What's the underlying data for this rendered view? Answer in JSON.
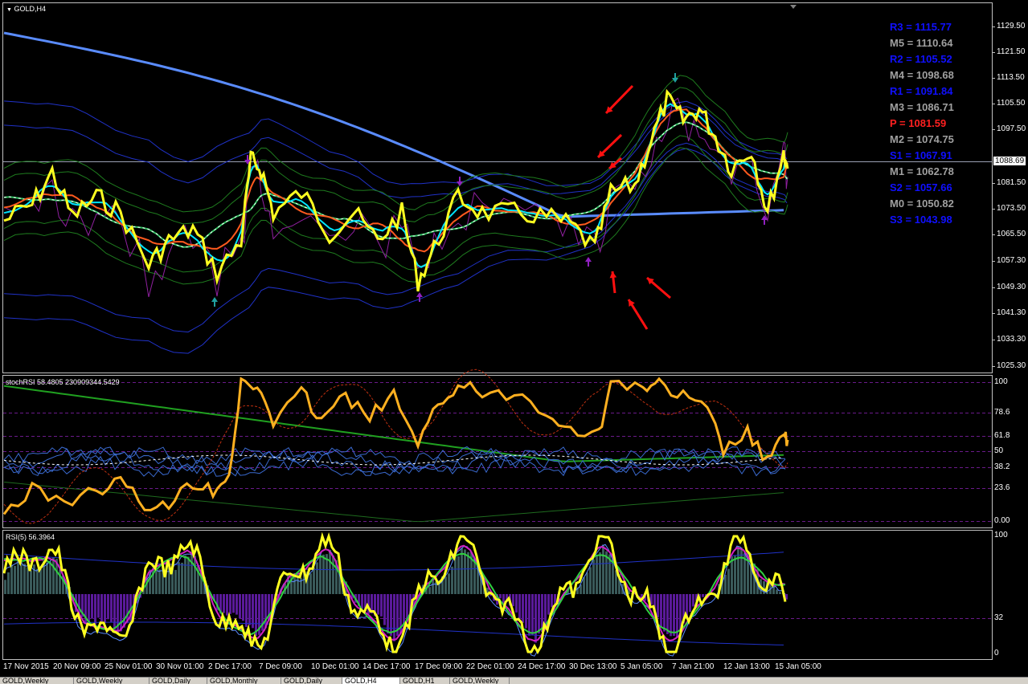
{
  "window": {
    "symbol_label": "GOLD,H4"
  },
  "pivots": [
    {
      "text": "R3 = 1115.77",
      "color": "#1010ff"
    },
    {
      "text": "M5 = 1110.64",
      "color": "#a0a0a0"
    },
    {
      "text": "R2 = 1105.52",
      "color": "#1010ff"
    },
    {
      "text": "M4 = 1098.68",
      "color": "#a0a0a0"
    },
    {
      "text": "R1 = 1091.84",
      "color": "#1010ff"
    },
    {
      "text": "M3 = 1086.71",
      "color": "#a0a0a0"
    },
    {
      "text": "P  = 1081.59",
      "color": "#ff2020"
    },
    {
      "text": "M2 = 1074.75",
      "color": "#a0a0a0"
    },
    {
      "text": "S1 = 1067.91",
      "color": "#1010ff"
    },
    {
      "text": "M1 = 1062.78",
      "color": "#a0a0a0"
    },
    {
      "text": "S2 = 1057.66",
      "color": "#1010ff"
    },
    {
      "text": "M0 = 1050.82",
      "color": "#a0a0a0"
    },
    {
      "text": "S3 = 1043.98",
      "color": "#1010ff"
    }
  ],
  "price_axis": [
    "1129.50",
    "1121.50",
    "1113.50",
    "1105.50",
    "1097.50",
    "1088.69",
    "1081.50",
    "1073.50",
    "1065.50",
    "1057.30",
    "1049.30",
    "1041.30",
    "1033.30",
    "1025.30"
  ],
  "current_price": "1088.69",
  "stoch_panel": {
    "title": "stochRSI 58.4805 230909344.5429",
    "axis": [
      "100",
      "78.6",
      "61.8",
      "50",
      "38.2",
      "23.6",
      "0.00"
    ]
  },
  "rsi_panel": {
    "title": "RSI(5) 56.3964",
    "axis": [
      "100",
      "32",
      "0"
    ]
  },
  "time_axis": [
    "17 Nov 2015",
    "20 Nov 09:00",
    "25 Nov 01:00",
    "30 Nov 01:00",
    "2 Dec 17:00",
    "7 Dec 09:00",
    "10 Dec 01:00",
    "14 Dec 17:00",
    "17 Dec 09:00",
    "22 Dec 01:00",
    "24 Dec 17:00",
    "30 Dec 13:00",
    "5 Jan 05:00",
    "7 Jan 21:00",
    "12 Jan 13:00",
    "15 Jan 05:00"
  ],
  "tabs": [
    {
      "label": "GOLD,Weekly",
      "active": false
    },
    {
      "label": "GOLD,Weekly",
      "active": false
    },
    {
      "label": "GOLD,Daily",
      "active": false
    },
    {
      "label": "GOLD,Monthly",
      "active": false
    },
    {
      "label": "GOLD,Daily",
      "active": false
    },
    {
      "label": "GOLD,H4",
      "active": true
    },
    {
      "label": "GOLD,H1",
      "active": false
    },
    {
      "label": "GOLD,Weekly",
      "active": false
    }
  ],
  "colors": {
    "price": "#ffff20",
    "fast_ma": "#00e5ff",
    "slow_ma": "#ff5a1e",
    "long_ma": "#5a8cff",
    "band": "#2032c8",
    "envelope": "#1e7a1e",
    "arrow": "#ff1010"
  }
}
